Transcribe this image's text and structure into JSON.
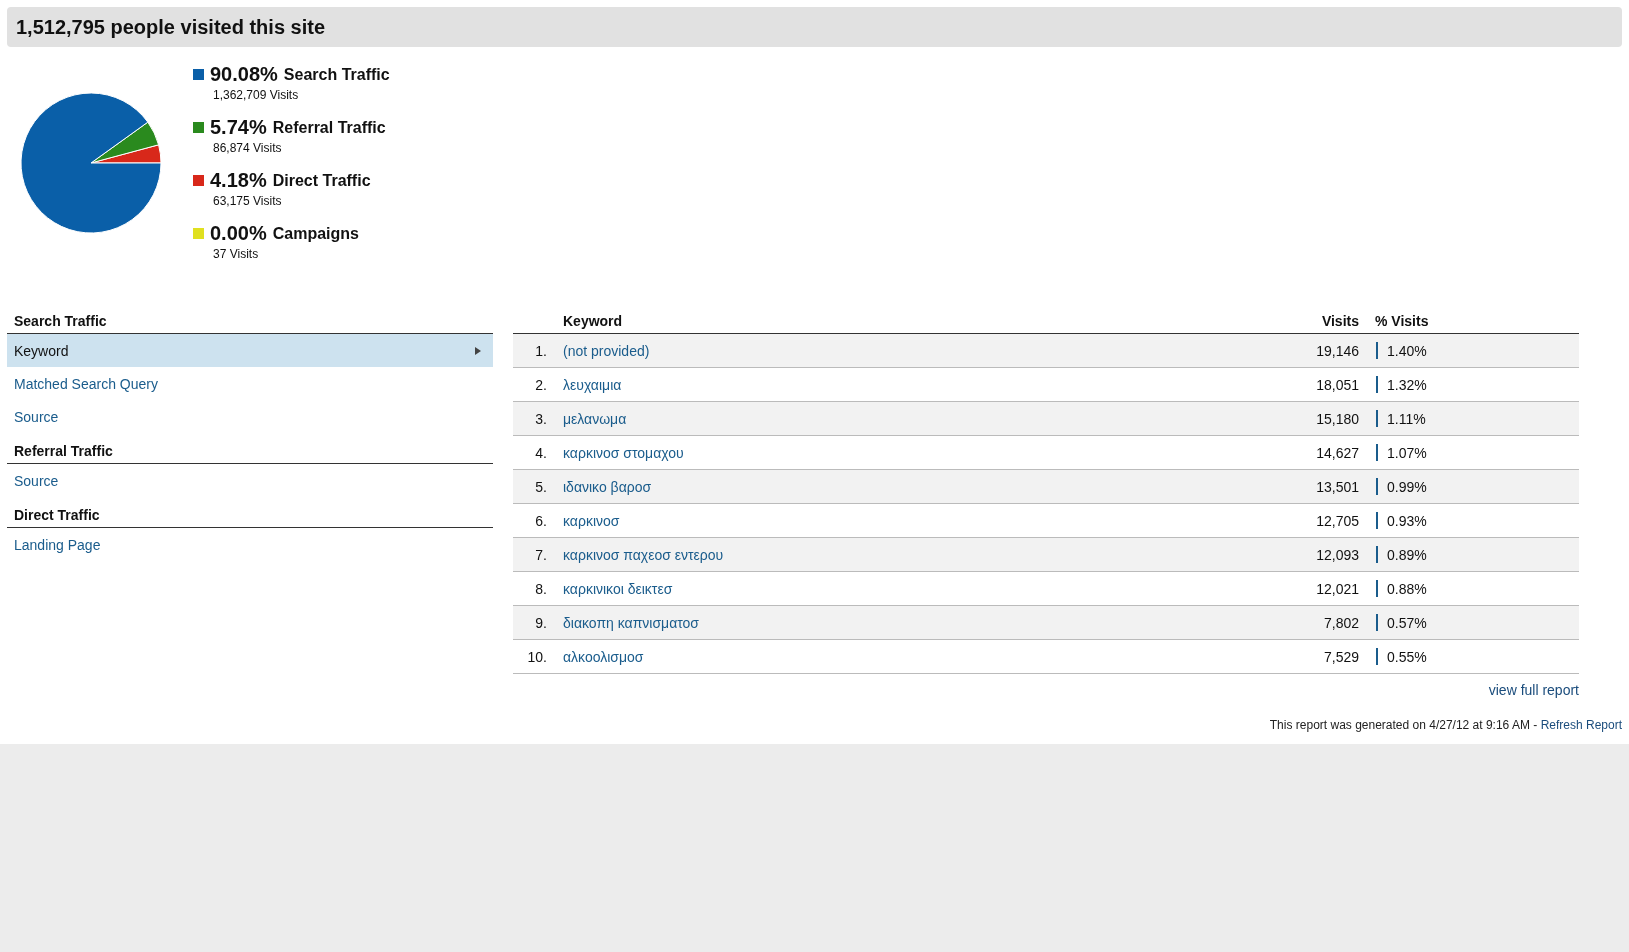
{
  "header": {
    "title": "1,512,795 people visited this site"
  },
  "overview": {
    "chart_data": {
      "type": "pie",
      "values": [
        90.08,
        5.74,
        4.18,
        0.0
      ]
    },
    "legend": [
      {
        "percent": "90.08%",
        "label": "Search Traffic",
        "visits": "1,362,709 Visits",
        "color": "#0a5fa8"
      },
      {
        "percent": "5.74%",
        "label": "Referral Traffic",
        "visits": "86,874 Visits",
        "color": "#2a8a1e"
      },
      {
        "percent": "4.18%",
        "label": "Direct Traffic",
        "visits": "63,175 Visits",
        "color": "#d8281a"
      },
      {
        "percent": "0.00%",
        "label": "Campaigns",
        "visits": "37 Visits",
        "color": "#e0e020"
      }
    ]
  },
  "sidebar": {
    "sections": [
      {
        "title": "Search Traffic",
        "items": [
          {
            "label": "Keyword",
            "selected": true
          },
          {
            "label": "Matched Search Query",
            "selected": false
          },
          {
            "label": "Source",
            "selected": false
          }
        ]
      },
      {
        "title": "Referral Traffic",
        "items": [
          {
            "label": "Source",
            "selected": false
          }
        ]
      },
      {
        "title": "Direct Traffic",
        "items": [
          {
            "label": "Landing Page",
            "selected": false
          }
        ]
      }
    ]
  },
  "table": {
    "columns": [
      "Keyword",
      "Visits",
      "% Visits"
    ],
    "rows": [
      {
        "rank": "1.",
        "keyword": "(not provided)",
        "visits": "19,146",
        "percent": "1.40%"
      },
      {
        "rank": "2.",
        "keyword": "λευχαιμια",
        "visits": "18,051",
        "percent": "1.32%"
      },
      {
        "rank": "3.",
        "keyword": "μελανωμα",
        "visits": "15,180",
        "percent": "1.11%"
      },
      {
        "rank": "4.",
        "keyword": "καρκινοσ στομαχου",
        "visits": "14,627",
        "percent": "1.07%"
      },
      {
        "rank": "5.",
        "keyword": "ιδανικο βαροσ",
        "visits": "13,501",
        "percent": "0.99%"
      },
      {
        "rank": "6.",
        "keyword": "καρκινοσ",
        "visits": "12,705",
        "percent": "0.93%"
      },
      {
        "rank": "7.",
        "keyword": "καρκινοσ παχεοσ εντερου",
        "visits": "12,093",
        "percent": "0.89%"
      },
      {
        "rank": "8.",
        "keyword": "καρκινικοι δεικτεσ",
        "visits": "12,021",
        "percent": "0.88%"
      },
      {
        "rank": "9.",
        "keyword": "διακοπη καπνισματοσ",
        "visits": "7,802",
        "percent": "0.57%"
      },
      {
        "rank": "10.",
        "keyword": "αλκοολισμοσ",
        "visits": "7,529",
        "percent": "0.55%"
      }
    ],
    "view_full_report": "view full report"
  },
  "footer": {
    "text": "This report was generated on 4/27/12 at 9:16 AM -",
    "link": "Refresh Report"
  }
}
